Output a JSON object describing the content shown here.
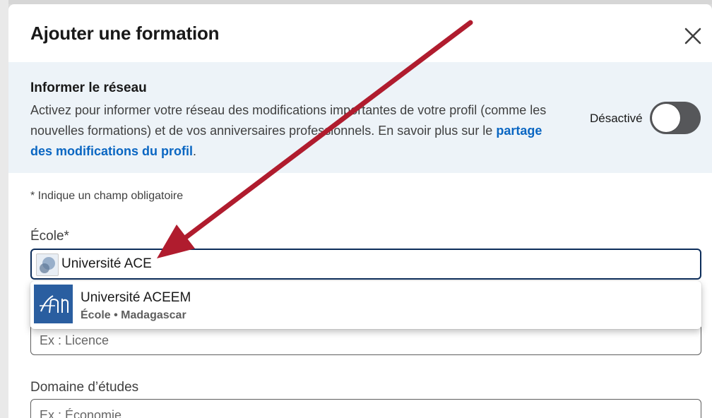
{
  "modal": {
    "title": "Ajouter une formation",
    "close_icon": "close-icon"
  },
  "notify": {
    "title": "Informer le réseau",
    "description": "Activez pour informer votre réseau des modifications importantes de votre profil (comme les nouvelles formations) et de vos anniversaires professionnels. En savoir plus sur le ",
    "link_text": "partage des modifications du profil",
    "trailing": ".",
    "toggle_label": "Désactivé",
    "toggle_on": false
  },
  "form": {
    "required_note": "* Indique un champ obligatoire",
    "school": {
      "label": "École*",
      "value": "Université ACE"
    },
    "suggestion": {
      "name": "Université ACEEM",
      "subtitle": "École • Madagascar"
    },
    "degree": {
      "placeholder": "Ex : Licence"
    },
    "field_of_study": {
      "label": "Domaine d’études",
      "placeholder": "Ex : Économie"
    }
  },
  "colors": {
    "accent": "#0a66c2",
    "toggle_off": "#56575a",
    "arrow": "#b01c2e",
    "notify_bg": "#edf3f8"
  }
}
